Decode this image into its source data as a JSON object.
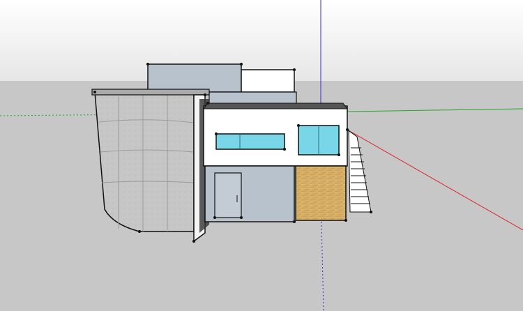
{
  "viewport": {
    "sky_color": "#ffffff",
    "horizon_color": "#e6e6e6",
    "ground_color": "#c7c7c7"
  },
  "axes": {
    "red_axis_color": "#e0202a",
    "green_axis_color": "#2aa02a",
    "blue_axis_color": "#3030d0"
  },
  "model": {
    "name": "house-model",
    "materials": {
      "concrete": "#c9c9c9",
      "wall_white": "#ffffff",
      "wall_gray": "#b8c2cc",
      "glass": "#79d6e8",
      "wood": "#d8b46a",
      "edge": "#111111"
    }
  }
}
